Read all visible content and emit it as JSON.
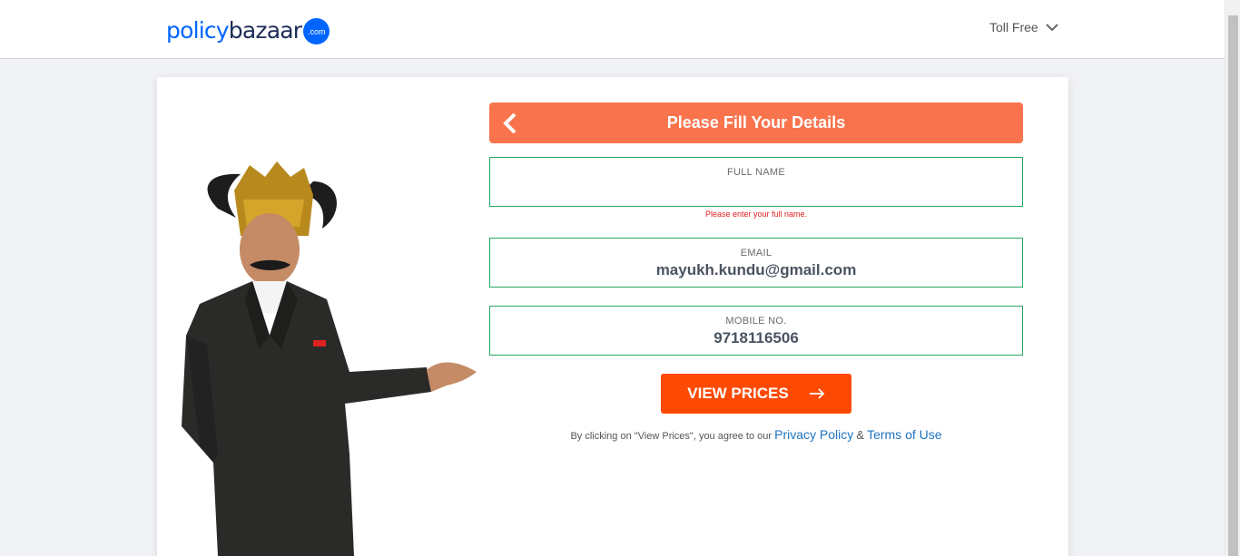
{
  "header": {
    "logo_policy": "policy",
    "logo_bazaar": "bazaar",
    "logo_badge": ".com",
    "toll_free_label": "Toll Free"
  },
  "form": {
    "title": "Please Fill Your Details",
    "full_name": {
      "label": "FULL NAME",
      "value": "",
      "error": "Please enter your full name."
    },
    "email": {
      "label": "EMAIL",
      "value": "mayukh.kundu@gmail.com"
    },
    "mobile": {
      "label": "MOBILE NO.",
      "value": "9718116506"
    },
    "submit_label": "VIEW PRICES",
    "terms_prefix": "By clicking on \"View Prices\", you agree to our",
    "privacy_link": "Privacy Policy",
    "terms_and": "&",
    "terms_link": "Terms of Use"
  },
  "colors": {
    "brand_blue": "#0065ff",
    "header_orange": "#f9744d",
    "cta_orange": "#fc4a04",
    "field_border": "#2ba763",
    "error_red": "#e0201e",
    "link_blue": "#1c72c2"
  },
  "icons": {
    "back": "chevron-left-icon",
    "toll_dropdown": "chevron-down-icon",
    "cta_arrow": "arrow-right-icon"
  }
}
